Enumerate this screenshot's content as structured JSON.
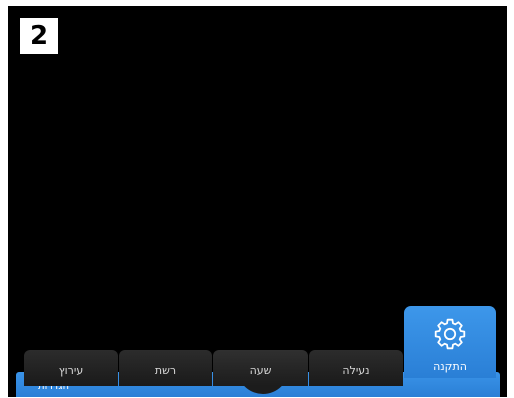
{
  "step_badge": "2",
  "tabs": {
    "inputs": "עירוץ",
    "network": "רשת",
    "time": "שעה",
    "lock": "נעילה",
    "setup": "התקנה"
  },
  "bottom_bar": {
    "label": "הגדרות"
  },
  "icons": {
    "setup": "gear-icon"
  },
  "colors": {
    "accent": "#2f88e0",
    "tab_bg": "#222222",
    "screen_bg": "#000000"
  }
}
